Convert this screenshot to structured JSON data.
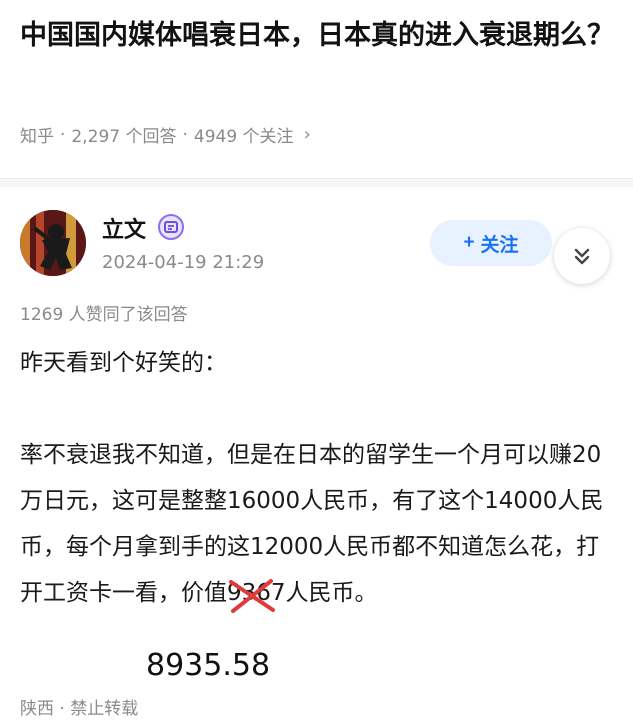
{
  "question": {
    "title": "中国国内媒体唱衰日本，日本真的进入衰退期么？",
    "meta": {
      "source": "知乎",
      "separator": "·",
      "answers": "2,297 个回答",
      "followers": "4949 个关注",
      "chevron": "›"
    }
  },
  "answer": {
    "author": {
      "name": "立文",
      "date": "2024-04-19 21:29",
      "badge_icon": "badge-icon"
    },
    "follow_button": {
      "plus": "+",
      "label": "关注"
    },
    "expand_icon": "chevron-double-down-icon",
    "votes": "1269 人赞同了该回答",
    "paragraph1": "昨天看到个好笑的：",
    "paragraph2_main": "率不衰退我不知道，但是在日本的留学生一个月可以赚20万日元，这可是整整16000人民币，有了这个14000人民币，每个月拿到手的这12000人民币都不知道怎么花，打开工资卡一看，价值",
    "paragraph2_struck": "9367",
    "paragraph2_tail": "人民币。",
    "handwritten_correction": "8935.58",
    "footer": {
      "location": "陕西",
      "separator": "·",
      "notice": "禁止转载"
    }
  },
  "colors": {
    "accent": "#1772f6",
    "follow_bg": "#e8f1ff",
    "meta_text": "#8a8a8a",
    "cross_mark": "#e03a3a"
  }
}
